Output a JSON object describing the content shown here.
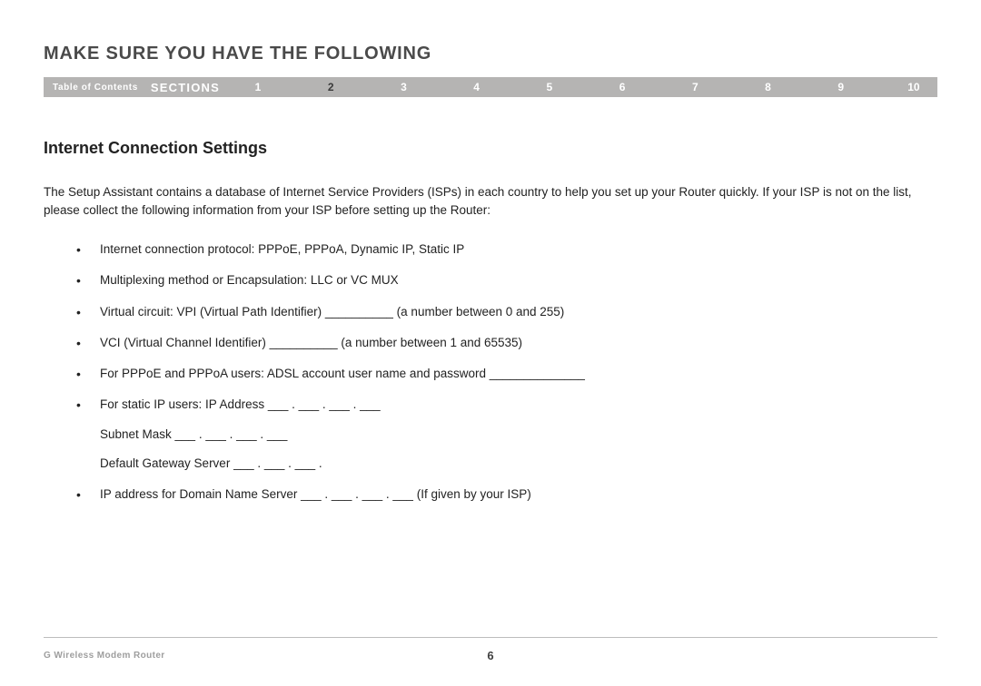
{
  "header": {
    "title": "MAKE SURE YOU HAVE THE FOLLOWING"
  },
  "navbar": {
    "toc": "Table of Contents",
    "sections_label": "SECTIONS",
    "items": [
      "1",
      "2",
      "3",
      "4",
      "5",
      "6",
      "7",
      "8",
      "9",
      "10"
    ],
    "active_index": 1
  },
  "content": {
    "subheading": "Internet Connection Settings",
    "intro": "The Setup Assistant contains a database of Internet Service Providers (ISPs) in each country to help you set up your Router quickly. If your ISP is not on the list, please collect the following information from your ISP before setting up the Router:",
    "bullets": [
      {
        "text": "Internet connection protocol: PPPoE, PPPoA, Dynamic IP, Static IP"
      },
      {
        "text": "Multiplexing method or Encapsulation: LLC or VC MUX"
      },
      {
        "text": "Virtual circuit: VPI (Virtual Path Identifier) __________ (a number between 0 and 255)"
      },
      {
        "text": "VCI (Virtual Channel Identifier) __________ (a number between 1 and 65535)"
      },
      {
        "text": "For PPPoE and PPPoA users: ADSL account user name and password ______________"
      },
      {
        "text": "For static IP users: IP Address ___ . ___ . ___ . ___",
        "sublines": [
          "Subnet Mask ___ . ___ . ___ . ___",
          "Default Gateway Server ___ . ___ . ___ ."
        ]
      },
      {
        "text": "IP address for Domain Name Server ___ . ___ . ___ . ___ (If given by your ISP)"
      }
    ]
  },
  "footer": {
    "product": "G Wireless Modem Router",
    "page_number": "6"
  }
}
